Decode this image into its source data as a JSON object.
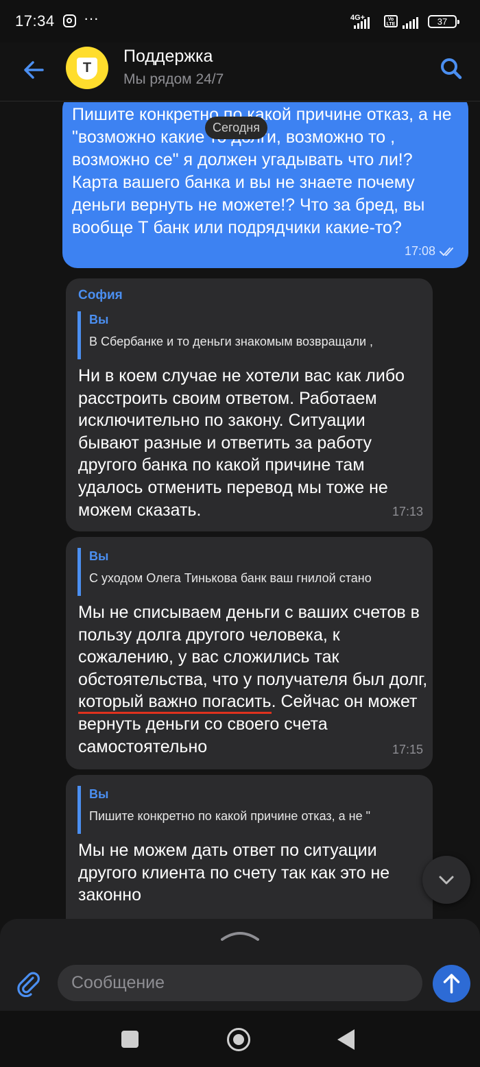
{
  "status_bar": {
    "time": "17:34",
    "dots": "···",
    "network": "4G+",
    "volte": "Vo LTE",
    "battery": "37"
  },
  "header": {
    "title": "Поддержка",
    "subtitle": "Мы рядом 24/7",
    "avatar_letter": "T",
    "accent_color": "#4B8FF1",
    "brand_color": "#FFDD2D"
  },
  "chat": {
    "date_separator": "Сегодня",
    "outgoing": {
      "text": "Пишите конкретно по какой причине отказ, а не \"возможно какие то долги, возможно то , возможно се\" я должен угадывать что ли!? Карта вашего банка и вы не знаете почему деньги вернуть не можете!? Что за бред, вы вообще Т банк или подрядчики какие-то?",
      "time": "17:08",
      "status_icon": "double-check-icon"
    },
    "messages": [
      {
        "sender": "София",
        "quote_name": "Вы",
        "quote_text": "В Сбербанке и то деньги знакомым возвращали ,",
        "text": "Ни в коем случае не хотели вас как либо расстроить своим ответом. Работаем исключительно по закону. Ситуации бывают разные и ответить за работу другого банка по какой при­чине там удалось отменить перевод мы тоже не можем сказать.",
        "time": "17:13"
      },
      {
        "quote_name": "Вы",
        "quote_text": "С уходом Олега Тинькова банк ваш гнилой стано",
        "text_before": "Мы не списываем деньги с ваших сче­тов в пользу долга другого человека, к сожалению, у вас сложились так обстоятельства, что у получателя был долг, ",
        "text_underlined": "который важно погасить",
        "text_after": ". Сейчас он может вернуть деньги со своего счета самостоятельно",
        "time": "17:15"
      },
      {
        "quote_name": "Вы",
        "quote_text": "Пишите конкретно по какой причине отказ, а не \"",
        "text": "Мы не можем дать ответ по ситуации другого клиента по счету так как это не законно"
      }
    ]
  },
  "composer": {
    "placeholder": "Сообщение"
  }
}
